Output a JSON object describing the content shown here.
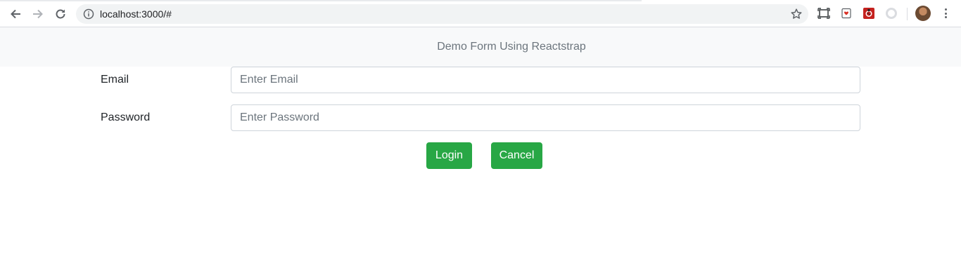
{
  "browser": {
    "url": "localhost:3000/#",
    "icons": [
      "back-icon",
      "forward-icon",
      "reload-icon",
      "info-icon",
      "bookmark-star-icon",
      "screenshot-extension-icon",
      "pocket-extension-icon",
      "ladybug-extension-icon",
      "dark-mode-extension-icon",
      "profile-avatar",
      "more-menu-icon"
    ]
  },
  "navbar": {
    "brand": "Demo Form Using Reactstrap"
  },
  "form": {
    "email_label": "Email",
    "email_placeholder": "Enter Email",
    "email_value": "",
    "password_label": "Password",
    "password_placeholder": "Enter Password",
    "password_value": "",
    "login_label": "Login",
    "cancel_label": "Cancel"
  },
  "colors": {
    "button_green": "#28a745",
    "navbar_bg": "#f8f9fa",
    "brand_text": "#6c757d"
  }
}
